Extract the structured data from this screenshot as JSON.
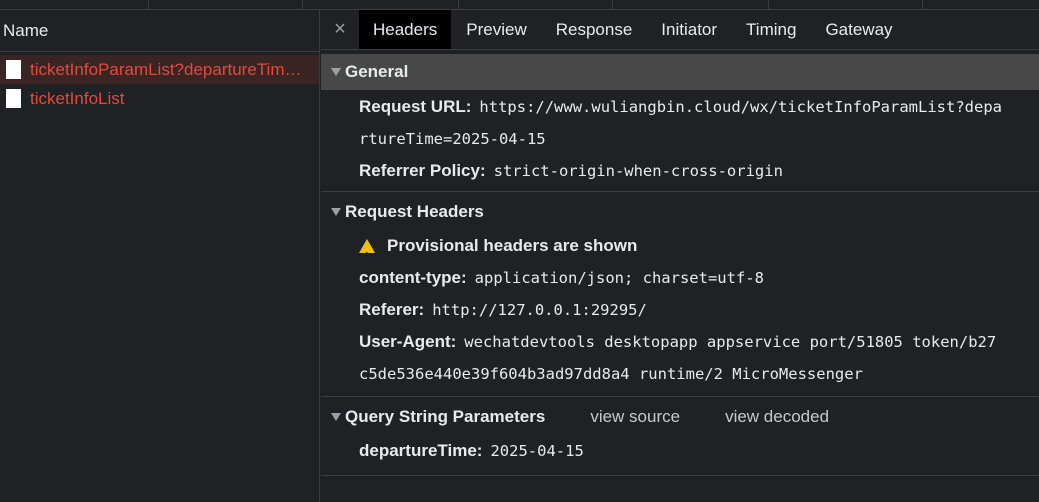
{
  "network_list": {
    "column_header": "Name",
    "requests": [
      {
        "name": "ticketInfoParamList?departureTim…",
        "selected": true
      },
      {
        "name": "ticketInfoList",
        "selected": false
      }
    ]
  },
  "tabs": {
    "close_glyph": "×",
    "items": [
      "Headers",
      "Preview",
      "Response",
      "Initiator",
      "Timing",
      "Gateway"
    ],
    "active": "Headers"
  },
  "general": {
    "title": "General",
    "request_url_key": "Request URL:",
    "request_url_line1": "https://www.wuliangbin.cloud/wx/ticketInfoParamList?depa",
    "request_url_line2": "rtureTime=2025-04-15",
    "referrer_policy_key": "Referrer Policy:",
    "referrer_policy_val": "strict-origin-when-cross-origin"
  },
  "request_headers": {
    "title": "Request Headers",
    "warning": "Provisional headers are shown",
    "content_type_key": "content-type:",
    "content_type_val": "application/json; charset=utf-8",
    "referer_key": "Referer:",
    "referer_val": "http://127.0.0.1:29295/",
    "user_agent_key": "User-Agent:",
    "user_agent_line1": "wechatdevtools desktopapp appservice port/51805 token/b27",
    "user_agent_line2": "c5de536e440e39f604b3ad97dd8a4 runtime/2 MicroMessenger"
  },
  "query_params": {
    "title": "Query String Parameters",
    "view_source": "view source",
    "view_decoded": "view decoded",
    "param_key": "departureTime:",
    "param_val": "2025-04-15"
  },
  "colors": {
    "background": "#202124",
    "request_name": "#e04b3c",
    "selected_row": "#3a2424",
    "general_header": "#484848",
    "warning": "#f2c200"
  }
}
